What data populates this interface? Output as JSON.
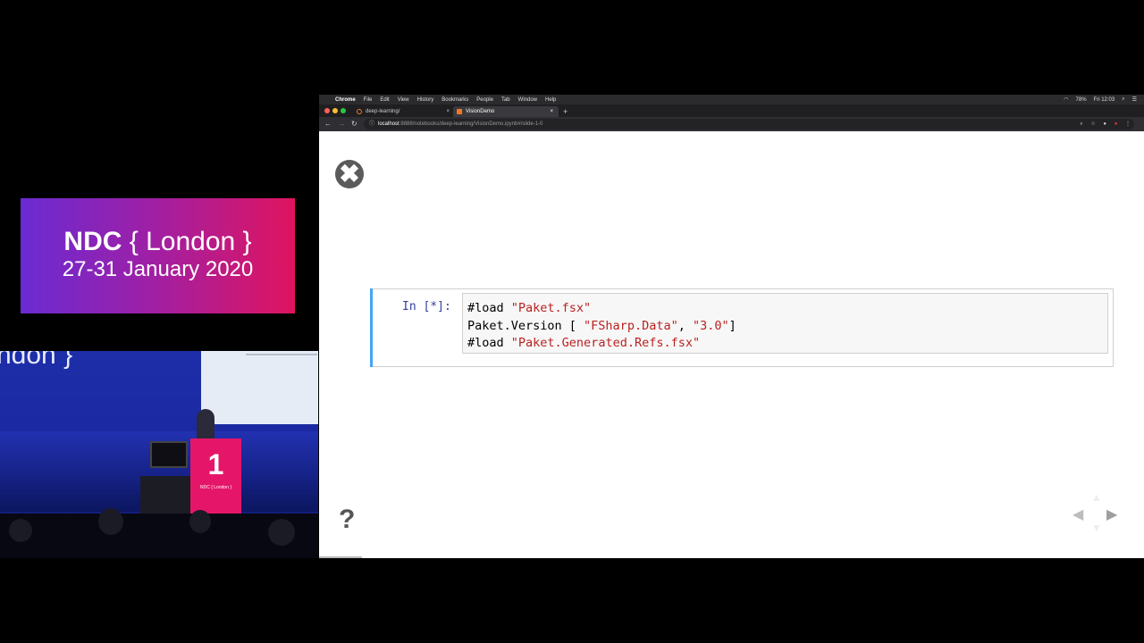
{
  "banner": {
    "event_prefix": "NDC",
    "event_city": "{ London }",
    "dates": "27-31 January 2020"
  },
  "stage": {
    "wall_text": "ndon }",
    "podium_number": "1",
    "podium_label": "NDC { London }"
  },
  "menubar": {
    "apple": "",
    "app": "Chrome",
    "items": [
      "File",
      "Edit",
      "View",
      "History",
      "Bookmarks",
      "People",
      "Tab",
      "Window",
      "Help"
    ],
    "battery": "78%",
    "clock": "Fri 12:03"
  },
  "tabs": [
    {
      "label": "deep-learning/",
      "close": "×"
    },
    {
      "label": "VisionDemo",
      "close": "×"
    }
  ],
  "new_tab": "+",
  "address": {
    "host": "localhost",
    "rest": ":8888/notebooks/deep-learning/VisionDemo.ipynb#/slide-1-0"
  },
  "slide": {
    "close_glyph": "✖",
    "prompt": "In [*]:",
    "code_lines": [
      {
        "kw": "#load ",
        "str": "\"Paket.fsx\""
      },
      {
        "kw": "Paket.Version [ ",
        "str": "\"FSharp.Data\"",
        "mid": ", ",
        "str2": "\"3.0\"",
        "end": "]"
      },
      {
        "kw": "#load ",
        "str": "\"Paket.Generated.Refs.fsx\""
      }
    ],
    "help_glyph": "?",
    "nav": {
      "left": "◀",
      "right": "▶",
      "up": "▲",
      "down": "▼"
    }
  },
  "colors": {
    "banner_start": "#6a2bd3",
    "banner_end": "#e0145f",
    "cell_accent": "#42a5f5",
    "string": "#ba2121"
  }
}
